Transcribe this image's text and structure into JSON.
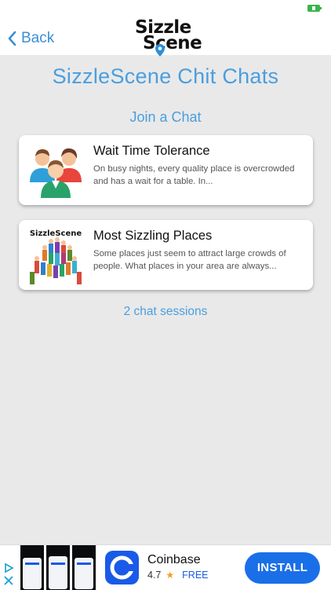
{
  "header": {
    "back_label": "Back",
    "logo_line1": "Sizzle",
    "logo_line2": "Scene"
  },
  "title": "SizzleScene Chit Chats",
  "join_label": "Join a Chat",
  "chats": [
    {
      "title": "Wait Time Tolerance",
      "description": "On busy nights, every quality place is overcrowded and has a wait for a table. In...",
      "thumb_icon": "people-group-icon"
    },
    {
      "title": "Most Sizzling Places",
      "description": "Some places just seem to attract large crowds of people. What places in your area are always...",
      "thumb_icon": "crowd-icon",
      "thumb_logo_text": "SizzleScene"
    }
  ],
  "sessions_label": "2 chat sessions",
  "ad": {
    "app_name": "Coinbase",
    "rating": "4.7",
    "price": "FREE",
    "install_label": "INSTALL",
    "colors": {
      "accent": "#1a6fe8",
      "logo_bg": "#1a5ae8"
    }
  },
  "colors": {
    "primary": "#4a9edf",
    "background": "#e9e9e9"
  }
}
